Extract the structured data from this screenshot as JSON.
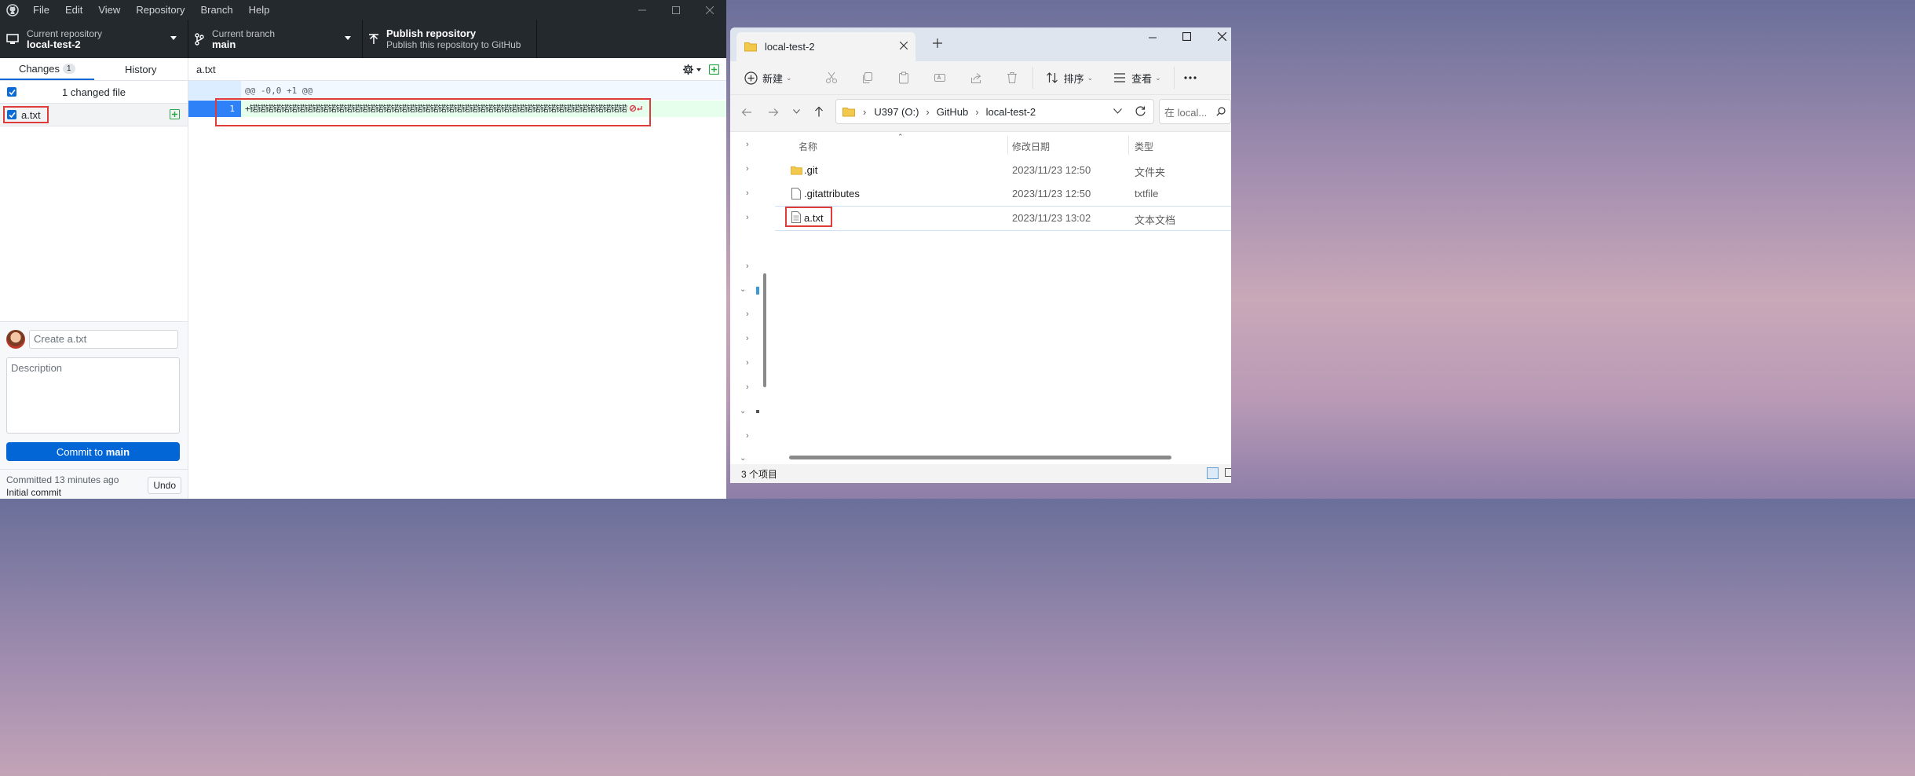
{
  "desktop": {
    "menu": [
      "File",
      "Edit",
      "View",
      "Repository",
      "Branch",
      "Help"
    ],
    "toolbar": {
      "repo_label": "Current repository",
      "repo_value": "local-test-2",
      "branch_label": "Current branch",
      "branch_value": "main",
      "publish_title": "Publish repository",
      "publish_sub": "Publish this repository to GitHub"
    },
    "tabs": {
      "changes": "Changes",
      "changes_count": "1",
      "history": "History"
    },
    "changed_summary": "1 changed file",
    "files": [
      {
        "name": "a.txt"
      }
    ],
    "diff": {
      "filename": "a.txt",
      "hunk_header": "@@ -0,0 +1 @@",
      "line_number": "1",
      "line_content": "+锘锘锘锘锘锘锘锘锘锘锘锘锘锘锘锘锘锘锘锘锘锘锘锘锘锘锘锘锘锘锘锘锘锘锘锘锘锘锘锘锘锘锘锘锘锘锘锘锘锘锘"
    },
    "commit": {
      "summary_placeholder": "Create a.txt",
      "description_placeholder": "Description",
      "button_prefix": "Commit to ",
      "button_branch": "main",
      "last_commit_time": "Committed 13 minutes ago",
      "last_commit_msg": "Initial commit",
      "undo": "Undo"
    }
  },
  "explorer": {
    "tab_title": "local-test-2",
    "commands": {
      "new": "新建",
      "sort": "排序",
      "view": "查看"
    },
    "breadcrumb": [
      "U397 (O:)",
      "GitHub",
      "local-test-2"
    ],
    "search_placeholder": "在 local...",
    "columns": {
      "name": "名称",
      "date": "修改日期",
      "type": "类型"
    },
    "files": [
      {
        "name": ".git",
        "date": "2023/11/23 12:50",
        "type": "文件夹",
        "icon": "folder-icon"
      },
      {
        "name": ".gitattributes",
        "date": "2023/11/23 12:50",
        "type": "txtfile",
        "icon": "file-icon"
      },
      {
        "name": "a.txt",
        "date": "2023/11/23 13:02",
        "type": "文本文档",
        "icon": "text-file-icon"
      }
    ],
    "status": "3 个项目"
  },
  "colors": {
    "accent": "#0366d6",
    "highlight": "#e03b3b",
    "added_bg": "#e6ffed"
  }
}
